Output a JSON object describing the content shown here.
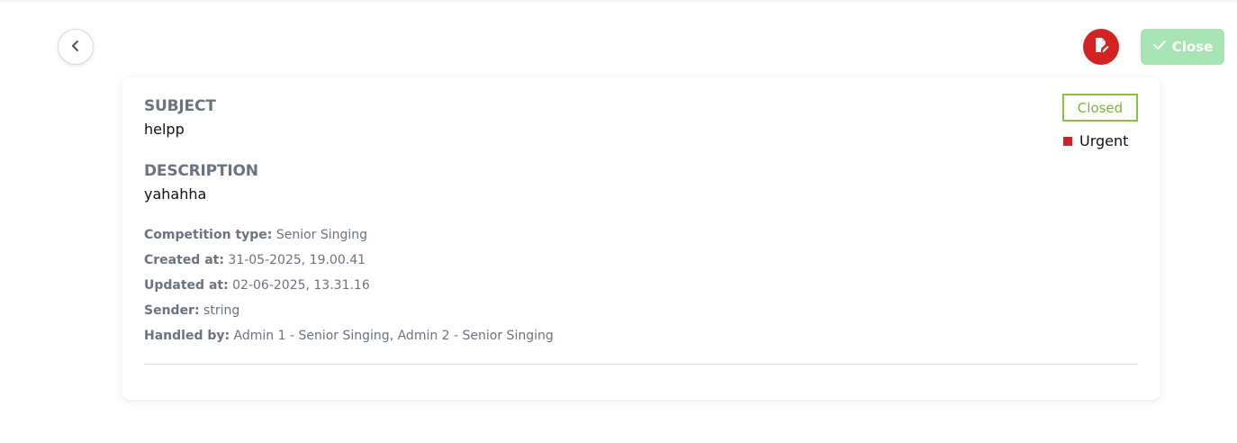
{
  "header": {
    "close_label": "Close"
  },
  "ticket": {
    "subject_label": "SUBJECT",
    "subject": "helpp",
    "description_label": "DESCRIPTION",
    "description": "yahahha",
    "status": "Closed",
    "priority": "Urgent",
    "meta": {
      "competition_type_label": "Competition type:",
      "competition_type": "Senior Singing",
      "created_at_label": "Created at:",
      "created_at": "31-05-2025, 19.00.41",
      "updated_at_label": "Updated at:",
      "updated_at": "02-06-2025, 13.31.16",
      "sender_label": "Sender:",
      "sender": "string",
      "handled_by_label": "Handled by:",
      "handled_by": "Admin 1 - Senior Singing, Admin 2 - Senior Singing"
    }
  },
  "colors": {
    "edit_button": "#d32222",
    "close_button": "#a7e4b4",
    "status_closed": "#84c441",
    "priority_urgent": "#d32222"
  },
  "icons": {
    "back": "chevron-left-icon",
    "edit": "document-edit-icon",
    "close": "check-icon"
  }
}
